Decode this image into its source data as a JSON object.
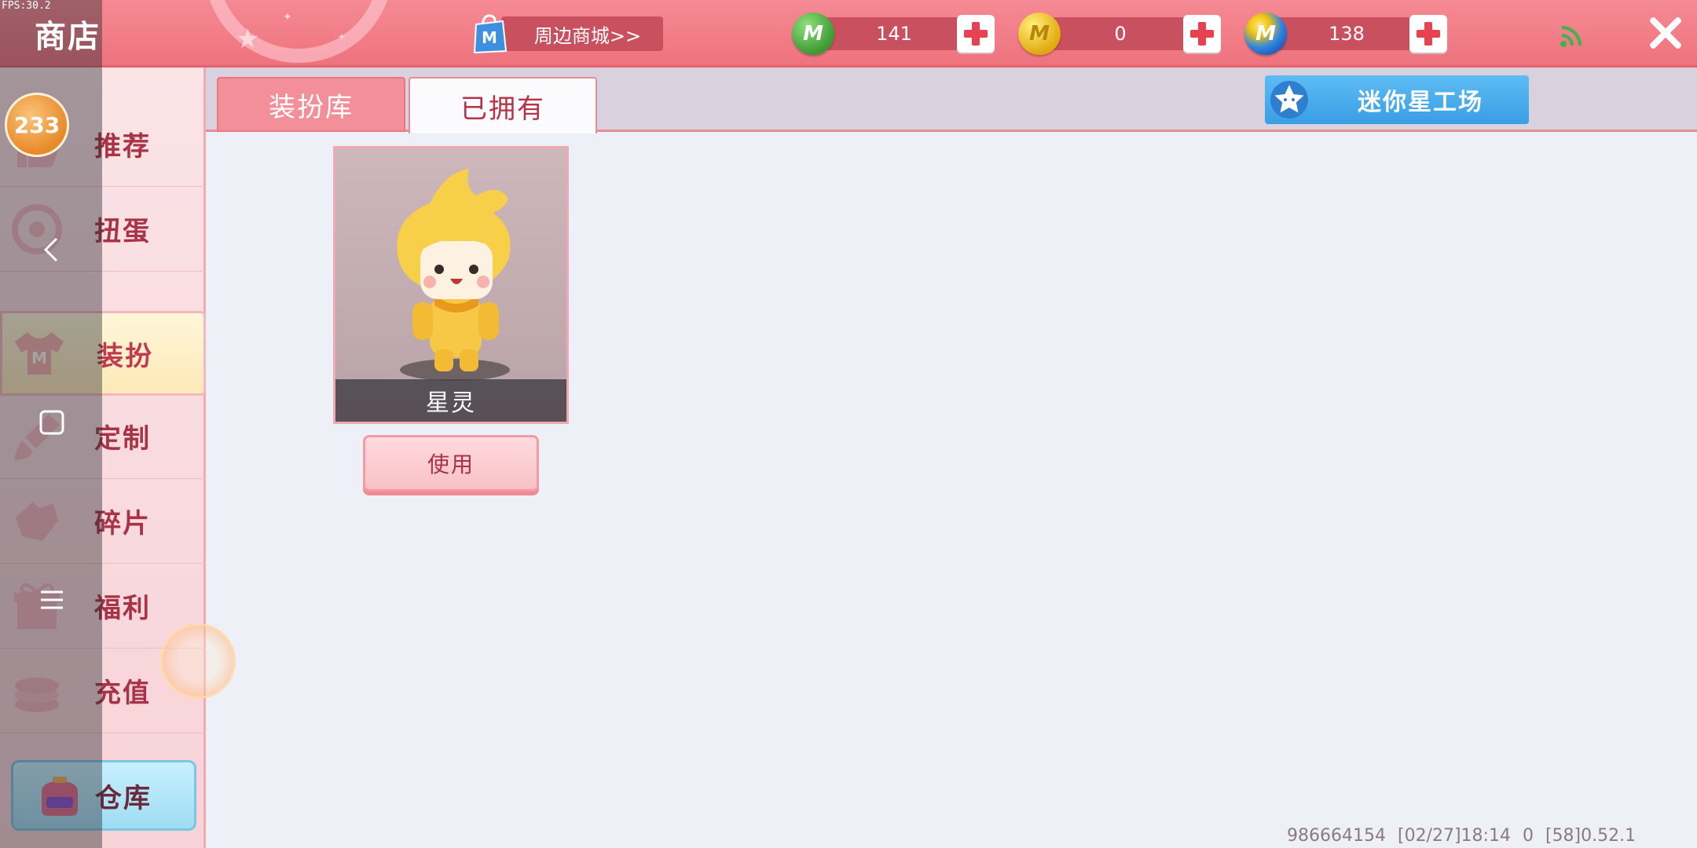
{
  "overlay": {
    "fps": "FPS:30.2"
  },
  "header": {
    "title": "商店",
    "merch_label": "周边商城>>",
    "currencies": [
      {
        "name": "mini-bean",
        "value": "141",
        "color": "#3d9a34"
      },
      {
        "name": "mini-coin",
        "value": "0",
        "color": "#e1a90f"
      },
      {
        "name": "mini-point",
        "value": "138",
        "color": "#2f86e0"
      }
    ],
    "coin_letter": "M"
  },
  "sidebar": {
    "badge": "233",
    "items": [
      {
        "label": "推荐",
        "icon": "thumbs-up-icon"
      },
      {
        "label": "扭蛋",
        "icon": "gashapon-icon"
      },
      {
        "label": "装扮",
        "icon": "tshirt-icon",
        "active": true
      },
      {
        "label": "定制",
        "icon": "brush-icon"
      },
      {
        "label": "碎片",
        "icon": "puzzle-icon"
      },
      {
        "label": "福利",
        "icon": "gift-icon"
      },
      {
        "label": "充值",
        "icon": "coins-icon"
      }
    ],
    "warehouse_label": "仓库"
  },
  "main": {
    "tabs": [
      {
        "label": "装扮库",
        "active": false
      },
      {
        "label": "已拥有",
        "active": true
      }
    ],
    "workshop_label": "迷你星工场",
    "items": [
      {
        "name": "星灵",
        "action": "使用"
      }
    ]
  },
  "footer": {
    "uid": "986664154",
    "time": "[02/27]18:14 0",
    "version": "[58]0.52.1"
  },
  "colors": {
    "topbar": "#f58a93",
    "accent": "#c9505e",
    "sidebar_text": "#a83246",
    "workshop": "#3a9ee4"
  }
}
